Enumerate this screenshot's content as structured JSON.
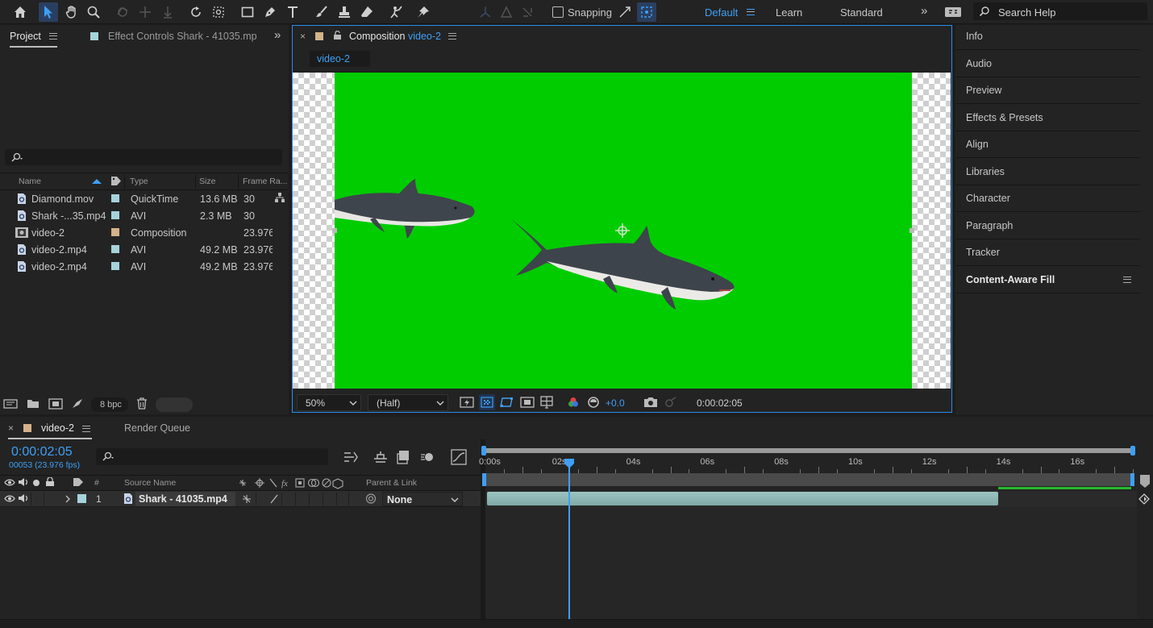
{
  "toolbar": {
    "snapping_label": "Snapping",
    "workspaces": [
      "Default",
      "Learn",
      "Standard"
    ],
    "search_placeholder": "Search Help",
    "active_workspace_color": "#3e9ff5"
  },
  "project_panel": {
    "tab_label": "Project",
    "effect_controls_label": "Effect Controls Shark - 41035.mp",
    "columns": [
      "Name",
      "Type",
      "Size",
      "Frame Ra..."
    ],
    "items": [
      {
        "name": "Diamond.mov",
        "type": "QuickTime",
        "size": "13.6 MB",
        "frame_rate": "30",
        "icon": "footage-icon",
        "color": "#a6d3db"
      },
      {
        "name": "Shark -...35.mp4",
        "type": "AVI",
        "size": "2.3 MB",
        "frame_rate": "30",
        "icon": "footage-icon",
        "color": "#a6d3db"
      },
      {
        "name": "video-2",
        "type": "Composition",
        "size": "",
        "frame_rate": "23.976",
        "icon": "composition-icon",
        "color": "#d4b28a"
      },
      {
        "name": "video-2.mp4",
        "type": "AVI",
        "size": "49.2 MB",
        "frame_rate": "23.976",
        "icon": "footage-icon",
        "color": "#a6d3db"
      },
      {
        "name": "video-2.mp4",
        "type": "AVI",
        "size": "49.2 MB",
        "frame_rate": "23.976",
        "icon": "footage-icon",
        "color": "#a6d3db"
      }
    ],
    "bpc_label": "8 bpc"
  },
  "composition_panel": {
    "tab_prefix": "Composition",
    "comp_name": "video-2",
    "breadcrumb": "video-2",
    "zoom": "50%",
    "resolution": "(Half)",
    "exposure": "+0.0",
    "timecode": "0:00:02:05",
    "background_color": "#00cc00"
  },
  "right_panel": {
    "items": [
      "Info",
      "Audio",
      "Preview",
      "Effects & Presets",
      "Align",
      "Libraries",
      "Character",
      "Paragraph",
      "Tracker",
      "Content-Aware Fill"
    ]
  },
  "timeline": {
    "tab_label": "video-2",
    "render_queue_label": "Render Queue",
    "current_time": "0:00:02:05",
    "frame_info": "00053 (23.976 fps)",
    "columns": {
      "number": "#",
      "source_name": "Source Name",
      "parent_link": "Parent & Link"
    },
    "ruler_labels": [
      "0:00s",
      "02s",
      "04s",
      "06s",
      "08s",
      "10s",
      "12s",
      "14s",
      "16s"
    ],
    "layers": [
      {
        "index": "1",
        "name": "Shark - 41035.mp4",
        "parent": "None",
        "label_color": "#a6d3db"
      }
    ]
  }
}
